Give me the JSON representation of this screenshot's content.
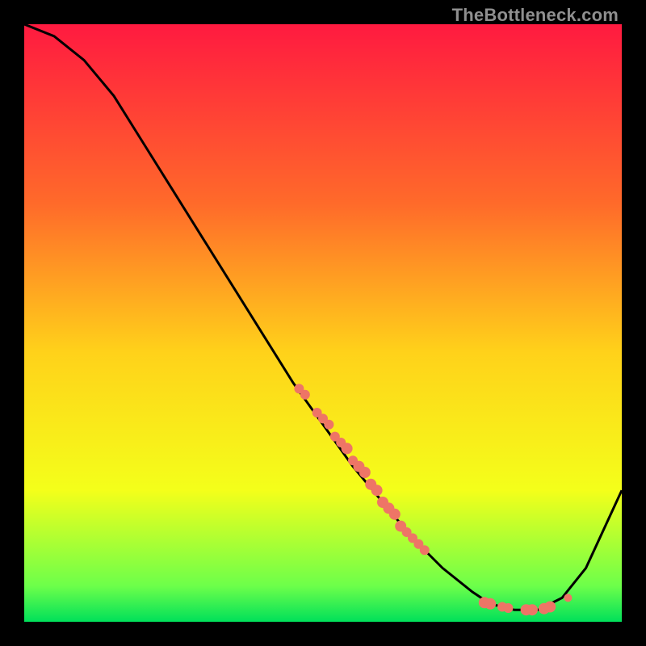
{
  "watermark": "TheBottleneck.com",
  "colors": {
    "background": "#000000",
    "curve": "#000000",
    "dot": "#ee7566",
    "gradient_top": "#ff1a40",
    "gradient_mid1": "#ff6a2a",
    "gradient_mid2": "#ffd21a",
    "gradient_mid3": "#f4ff1a",
    "gradient_bottom1": "#6dff4a",
    "gradient_bottom2": "#00e05a"
  },
  "chart_data": {
    "type": "line",
    "title": "",
    "xlabel": "",
    "ylabel": "",
    "xlim": [
      0,
      100
    ],
    "ylim": [
      0,
      100
    ],
    "series": [
      {
        "name": "bottleneck-curve",
        "x": [
          0,
          5,
          10,
          15,
          20,
          25,
          30,
          35,
          40,
          45,
          50,
          55,
          60,
          65,
          70,
          75,
          78,
          82,
          86,
          90,
          94,
          100
        ],
        "y": [
          100,
          98,
          94,
          88,
          80,
          72,
          64,
          56,
          48,
          40,
          33,
          26,
          20,
          14,
          9,
          5,
          3,
          2,
          2,
          4,
          9,
          22
        ]
      }
    ],
    "highlight_points": {
      "name": "highlight-dots",
      "x": [
        46,
        47,
        49,
        50,
        51,
        52,
        53,
        54,
        55,
        56,
        57,
        58,
        59,
        60,
        61,
        62,
        63,
        64,
        65,
        66,
        67,
        77,
        78,
        80,
        81,
        84,
        85,
        87,
        88,
        91
      ],
      "y": [
        39,
        38,
        35,
        34,
        33,
        31,
        30,
        29,
        27,
        26,
        25,
        23,
        22,
        20,
        19,
        18,
        16,
        15,
        14,
        13,
        12,
        3.2,
        3,
        2.5,
        2.3,
        2,
        2,
        2.2,
        2.5,
        4
      ],
      "radius": [
        6,
        6,
        6,
        6,
        6,
        6,
        6,
        7,
        6,
        7,
        7,
        7,
        7,
        7,
        7,
        7,
        7,
        6,
        6,
        6,
        6,
        7,
        7,
        6,
        6,
        7,
        7,
        7,
        7,
        5
      ]
    }
  }
}
